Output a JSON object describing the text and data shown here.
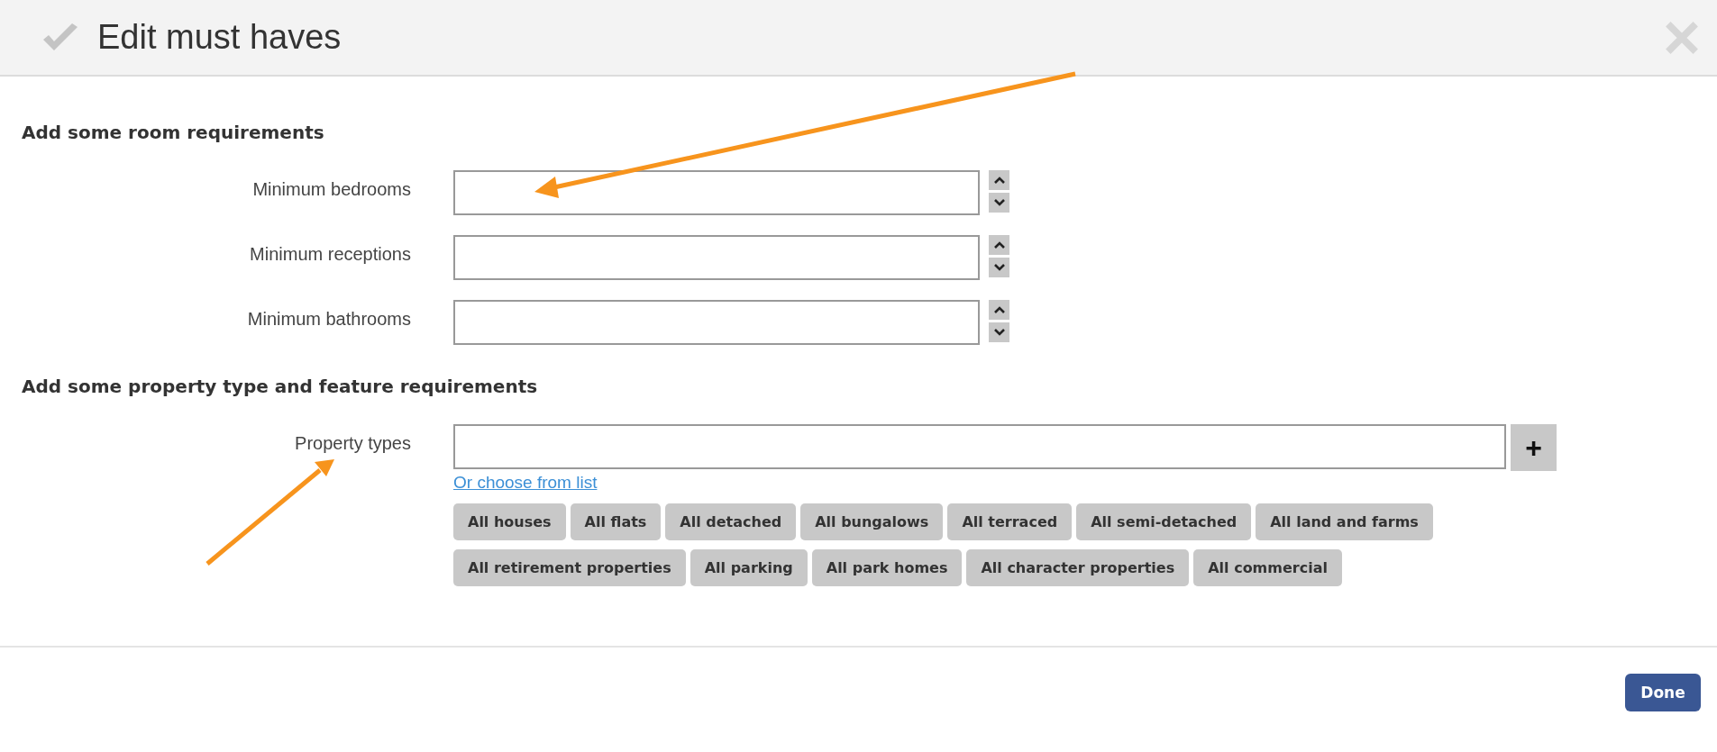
{
  "dialog": {
    "title": "Edit must haves"
  },
  "room_section": {
    "heading": "Add some room requirements",
    "fields": [
      {
        "label": "Minimum bedrooms"
      },
      {
        "label": "Minimum receptions"
      },
      {
        "label": "Minimum bathrooms"
      }
    ]
  },
  "property_section": {
    "heading": "Add some property type and feature requirements",
    "field": {
      "label": "Property types",
      "add_button": "+"
    },
    "link": "Or choose from list",
    "chips": [
      "All houses",
      "All flats",
      "All detached",
      "All bungalows",
      "All terraced",
      "All semi-detached",
      "All land and farms",
      "All retirement properties",
      "All parking",
      "All park homes",
      "All character properties",
      "All commercial"
    ]
  },
  "footer": {
    "done_button": "Done"
  }
}
